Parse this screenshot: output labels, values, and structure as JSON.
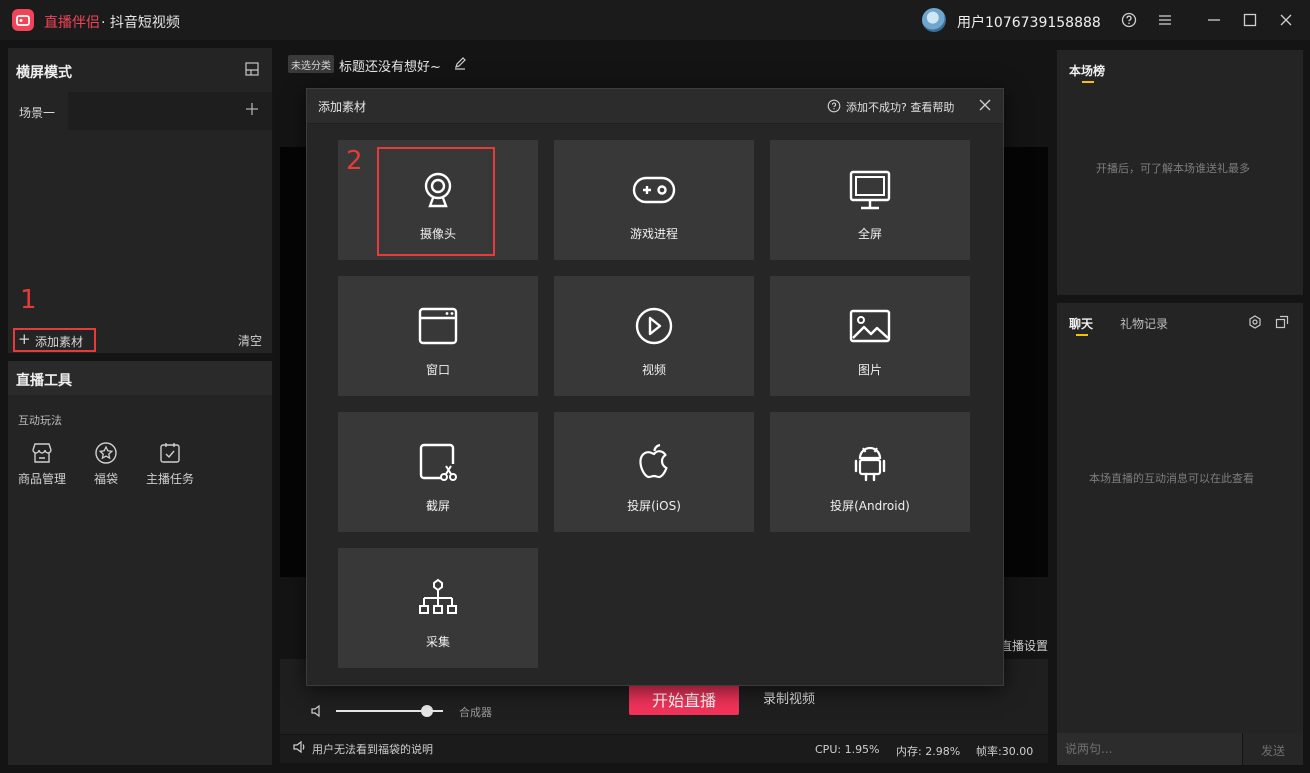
{
  "titlebar": {
    "app_name": "直播伴侣",
    "app_sub": "· 抖音短视频",
    "username": "用户1076739158888",
    "icons": [
      "help-icon",
      "menu-icon",
      "minimize-icon",
      "maximize-icon",
      "close-icon"
    ]
  },
  "left_panel": {
    "mode_title": "横屏模式",
    "scene_tab": "场景一",
    "annotation_1": "1",
    "add_material": "添加素材",
    "clear": "清空",
    "tools_title": "直播工具",
    "interact_label": "互动玩法",
    "tools": [
      {
        "label": "商品管理",
        "icon": "shop-icon"
      },
      {
        "label": "福袋",
        "icon": "star-bag-icon"
      },
      {
        "label": "主播任务",
        "icon": "task-icon"
      }
    ]
  },
  "center": {
    "category_chip": "未选分类",
    "title": "标题还没有想好~",
    "live_settings": "直播设置",
    "start_live": "开始直播",
    "record_video": "录制视频",
    "volume": 0.85,
    "mixer_label": "合成器",
    "notice": "用户无法看到福袋的说明",
    "cpu": "CPU: 1.95%",
    "memory": "内存: 2.98%",
    "fps": "帧率:30.00"
  },
  "right_panel": {
    "rank_title": "本场榜",
    "rank_empty": "开播后，可了解本场谁送礼最多",
    "chat_tab": "聊天",
    "gift_tab": "礼物记录",
    "chat_empty": "本场直播的互动消息可以在此查看",
    "chat_placeholder": "说两句...",
    "send": "发送"
  },
  "modal": {
    "title": "添加素材",
    "help": "添加不成功? 查看帮助",
    "annotation_2": "2",
    "tiles": [
      {
        "label": "摄像头",
        "icon": "camera-icon"
      },
      {
        "label": "游戏进程",
        "icon": "gamepad-icon"
      },
      {
        "label": "全屏",
        "icon": "monitor-icon"
      },
      {
        "label": "窗口",
        "icon": "window-icon"
      },
      {
        "label": "视频",
        "icon": "play-icon"
      },
      {
        "label": "图片",
        "icon": "image-icon"
      },
      {
        "label": "截屏",
        "icon": "screenshot-icon"
      },
      {
        "label": "投屏(iOS)",
        "icon": "apple-icon"
      },
      {
        "label": "投屏(Android)",
        "icon": "android-icon"
      },
      {
        "label": "采集",
        "icon": "capture-icon"
      }
    ]
  },
  "colors": {
    "brand": "#f24458",
    "start_live": "#f2335a",
    "annotation": "#e53b3b",
    "tab_underline": "#f5c400"
  }
}
